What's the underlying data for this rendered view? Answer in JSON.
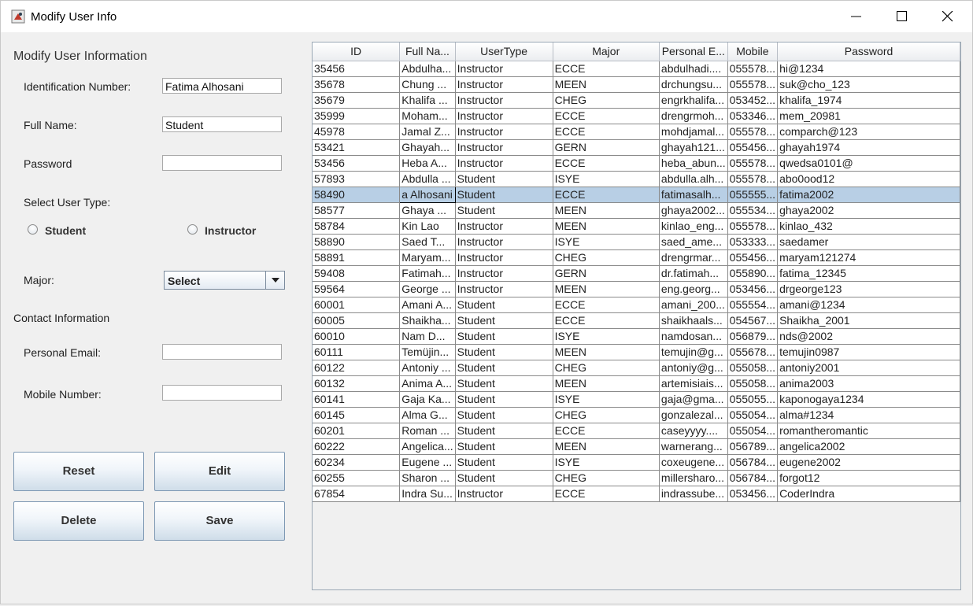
{
  "window": {
    "title": "Modify User Info"
  },
  "form": {
    "heading": "Modify User Information",
    "id_label": "Identification Number:",
    "id_value": "Fatima Alhosani",
    "fullname_label": "Full Name:",
    "fullname_value": "Student",
    "password_label": "Password",
    "password_value": "",
    "usertype_label": "Select User Type:",
    "radio_student": "Student",
    "radio_instructor": "Instructor",
    "major_label": "Major:",
    "major_value": "Select",
    "contact_heading": "Contact Information",
    "email_label": "Personal Email:",
    "email_value": "",
    "mobile_label": "Mobile Number:",
    "mobile_value": ""
  },
  "buttons": {
    "reset": "Reset",
    "edit": "Edit",
    "delete": "Delete",
    "save": "Save"
  },
  "table": {
    "columns": [
      "ID",
      "Full Na...",
      "UserType",
      "Major",
      "Personal E...",
      "Mobile",
      "Password"
    ],
    "selected_row": 8,
    "editing_cell_text": "a Alhosani",
    "rows": [
      [
        "35456",
        "Abdulha...",
        "Instructor",
        "ECCE",
        "abdulhadi....",
        "055578...",
        "hi@1234"
      ],
      [
        "35678",
        "Chung ...",
        "Instructor",
        "MEEN",
        "drchungsu...",
        "055578...",
        "suk@cho_123"
      ],
      [
        "35679",
        "Khalifa ...",
        "Instructor",
        "CHEG",
        "engrkhalifa...",
        "053452...",
        "khalifa_1974"
      ],
      [
        "35999",
        "Moham...",
        "Instructor",
        "ECCE",
        "drengrmoh...",
        "053346...",
        "mem_20981"
      ],
      [
        "45978",
        "Jamal Z...",
        "Instructor",
        "ECCE",
        "mohdjamal...",
        "055578...",
        "comparch@123"
      ],
      [
        "53421",
        "Ghayah...",
        "Instructor",
        "GERN",
        "ghayah121...",
        "055456...",
        "ghayah1974"
      ],
      [
        "53456",
        "Heba A...",
        "Instructor",
        "ECCE",
        "heba_abun...",
        "055578...",
        "qwedsa0101@"
      ],
      [
        "57893",
        "Abdulla ...",
        "Student",
        "ISYE",
        "abdulla.alh...",
        "055578...",
        "abo0ood12"
      ],
      [
        "58490",
        "a Alhosani",
        "Student",
        "ECCE",
        "fatimasalh...",
        "055555...",
        "fatima2002"
      ],
      [
        "58577",
        "Ghaya ...",
        "Student",
        "MEEN",
        "ghaya2002...",
        "055534...",
        "ghaya2002"
      ],
      [
        "58784",
        "Kin Lao",
        "Instructor",
        "MEEN",
        "kinlao_eng...",
        "055578...",
        "kinlao_432"
      ],
      [
        "58890",
        "Saed T...",
        "Instructor",
        "ISYE",
        "saed_ame...",
        "053333...",
        "saedamer"
      ],
      [
        "58891",
        "Maryam...",
        "Instructor",
        "CHEG",
        "drengrmar...",
        "055456...",
        "maryam121274"
      ],
      [
        "59408",
        "Fatimah...",
        "Instructor",
        "GERN",
        "dr.fatimah...",
        "055890...",
        "fatima_12345"
      ],
      [
        "59564",
        "George ...",
        "Instructor",
        "MEEN",
        "eng.georg...",
        "053456...",
        "drgeorge123"
      ],
      [
        "60001",
        "Amani A...",
        "Student",
        "ECCE",
        "amani_200...",
        "055554...",
        "amani@1234"
      ],
      [
        "60005",
        "Shaikha...",
        "Student",
        "ECCE",
        "shaikhaals...",
        "054567...",
        "Shaikha_2001"
      ],
      [
        "60010",
        "Nam D...",
        "Student",
        "ISYE",
        "namdosan...",
        "056879...",
        "nds@2002"
      ],
      [
        "60111",
        "Temüjin...",
        "Student",
        "MEEN",
        "temujin@g...",
        "055678...",
        "temujin0987"
      ],
      [
        "60122",
        "Antoniy ...",
        "Student",
        "CHEG",
        "antoniy@g...",
        "055058...",
        "antoniy2001"
      ],
      [
        "60132",
        "Anima A...",
        "Student",
        "MEEN",
        "artemisiais...",
        "055058...",
        "anima2003"
      ],
      [
        "60141",
        "Gaja Ka...",
        "Student",
        "ISYE",
        "gaja@gma...",
        "055055...",
        "kaponogaya1234"
      ],
      [
        "60145",
        "Alma G...",
        "Student",
        "CHEG",
        "gonzalezal...",
        "055054...",
        "alma#1234"
      ],
      [
        "60201",
        "Roman ...",
        "Student",
        "ECCE",
        "caseyyyy....",
        "055054...",
        "romantheromantic"
      ],
      [
        "60222",
        "Angelica...",
        "Student",
        "MEEN",
        "warnerang...",
        "056789...",
        "angelica2002"
      ],
      [
        "60234",
        "Eugene ...",
        "Student",
        "ISYE",
        "coxeugene...",
        "056784...",
        "eugene2002"
      ],
      [
        "60255",
        "Sharon ...",
        "Student",
        "CHEG",
        "millersharo...",
        "056784...",
        "forgot12"
      ],
      [
        "67854",
        "Indra Su...",
        "Instructor",
        "ECCE",
        "indrassube...",
        "053456...",
        "CoderIndra"
      ]
    ]
  }
}
